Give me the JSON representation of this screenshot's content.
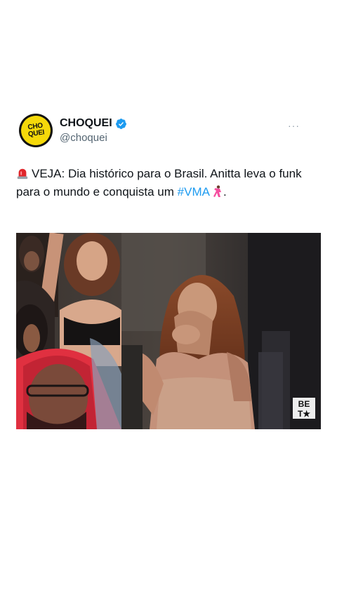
{
  "account": {
    "display_name": "CHOQUEI",
    "handle": "@choquei",
    "avatar_text_top": "CHO",
    "avatar_text_bottom": "QUEI",
    "verified": true,
    "brand_color": "#f5d90a"
  },
  "tweet": {
    "prefix": "VEJA: Dia histórico para o Brasil. Anitta leva o funk para o mundo e conquista um",
    "hashtag": "#VMA",
    "suffix": ".",
    "more_label": "···"
  },
  "media": {
    "watermark_top": "BE",
    "watermark_bottom": "T★"
  },
  "colors": {
    "link": "#1d9bf0",
    "verified_badge": "#1d9bf0"
  },
  "icons": [
    "siren-icon",
    "dancer-icon",
    "verified-icon",
    "more-icon"
  ]
}
